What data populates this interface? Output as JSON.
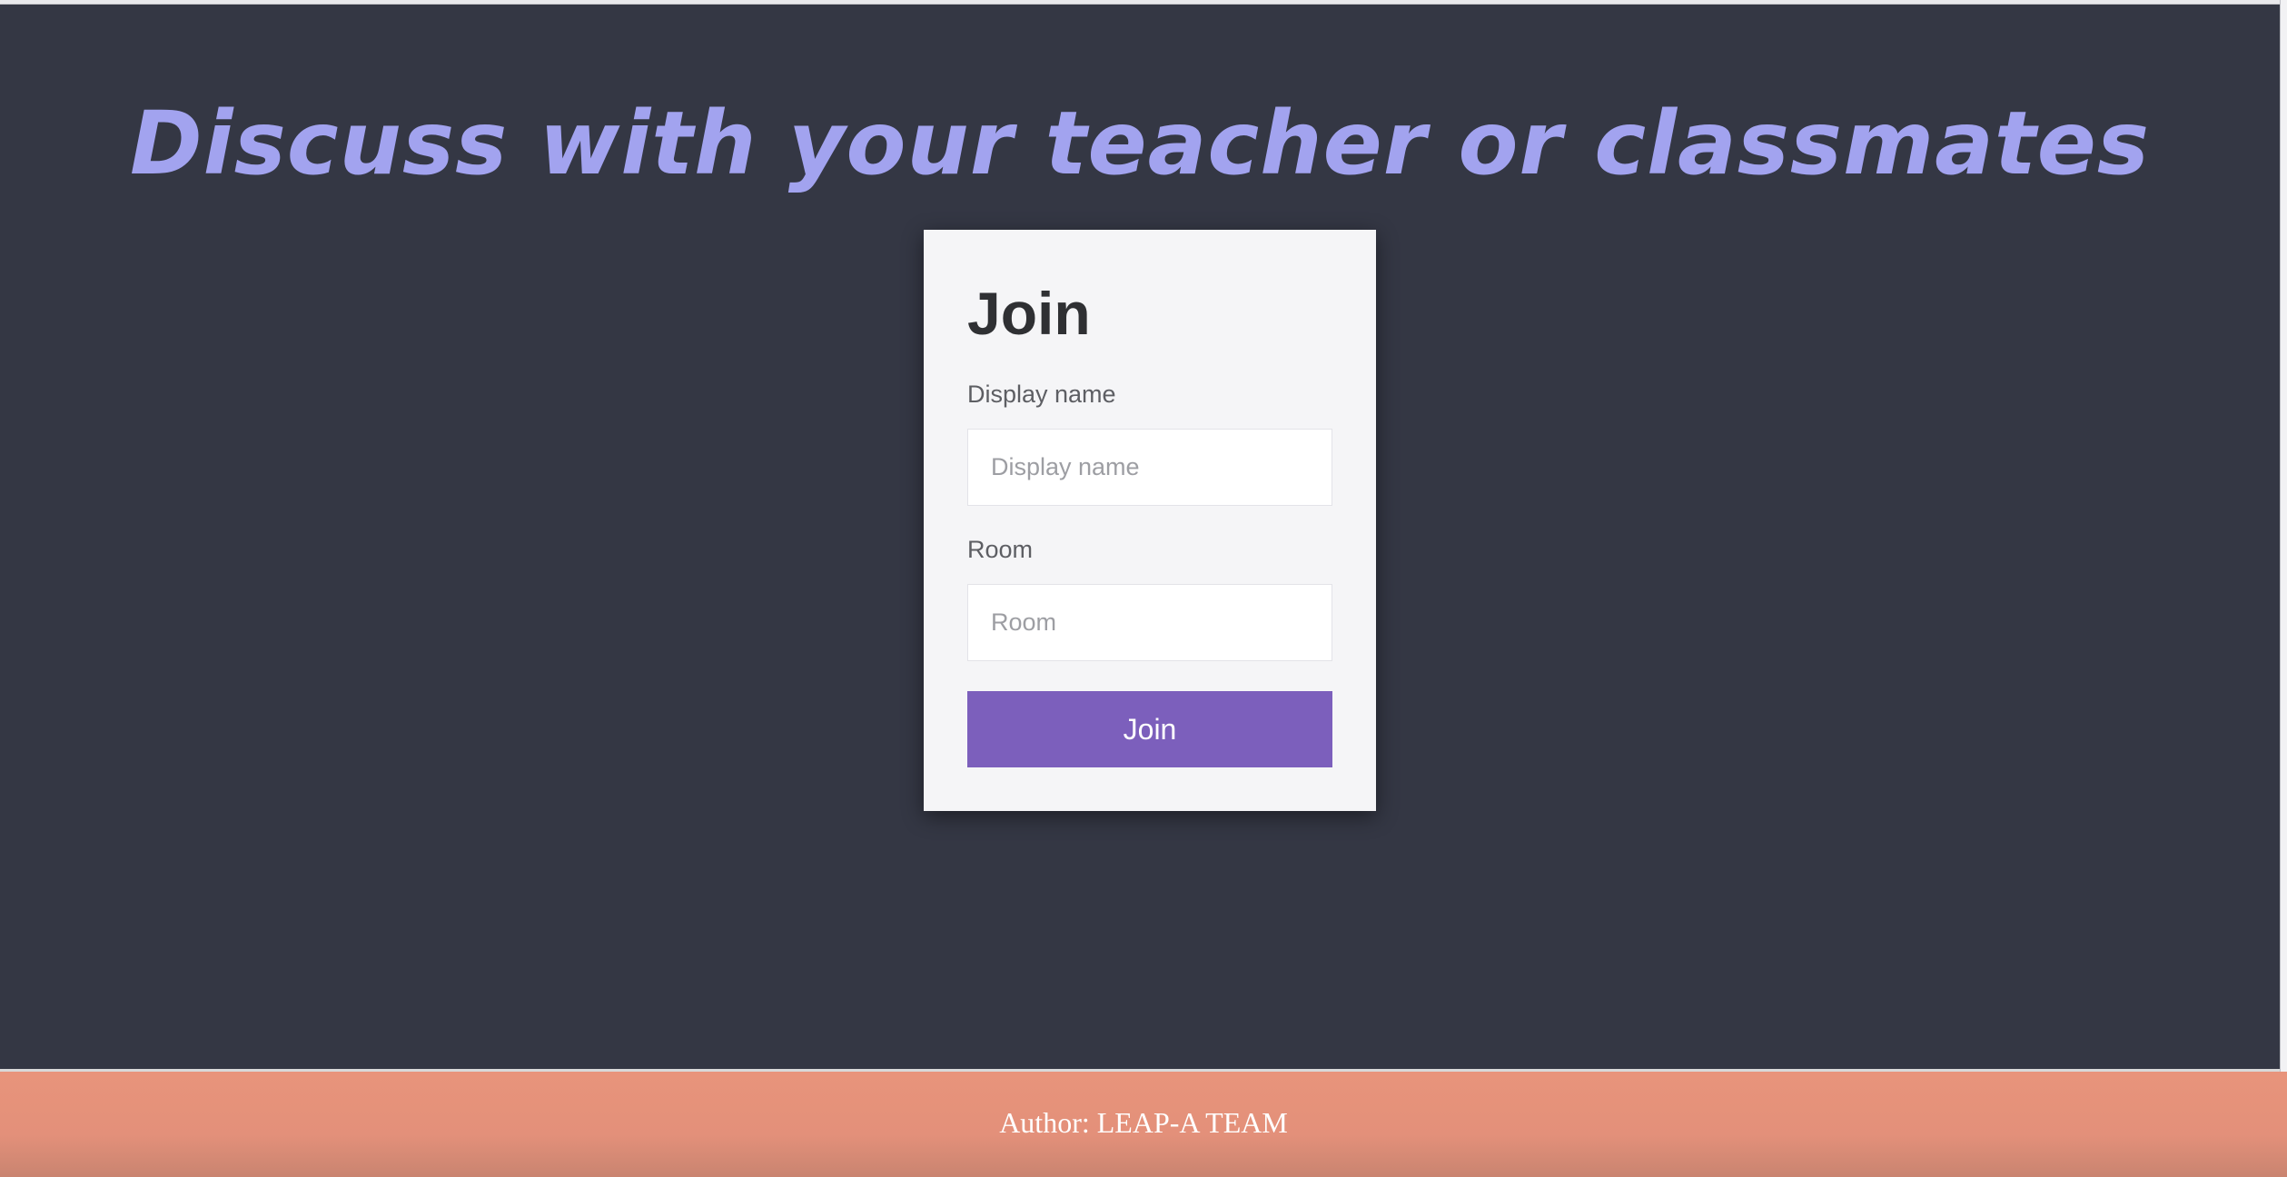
{
  "page": {
    "headline": "Discuss with your teacher or classmates"
  },
  "join_form": {
    "title": "Join",
    "display_name_label": "Display name",
    "display_name_placeholder": "Display name",
    "display_name_value": "",
    "room_label": "Room",
    "room_placeholder": "Room",
    "room_value": "",
    "submit_label": "Join"
  },
  "footer": {
    "text": "Author: LEAP-A TEAM"
  },
  "colors": {
    "background": "#343744",
    "headline": "#a2a3ef",
    "card": "#f5f5f7",
    "button": "#7c5fbc",
    "footer": "#e8947b"
  }
}
